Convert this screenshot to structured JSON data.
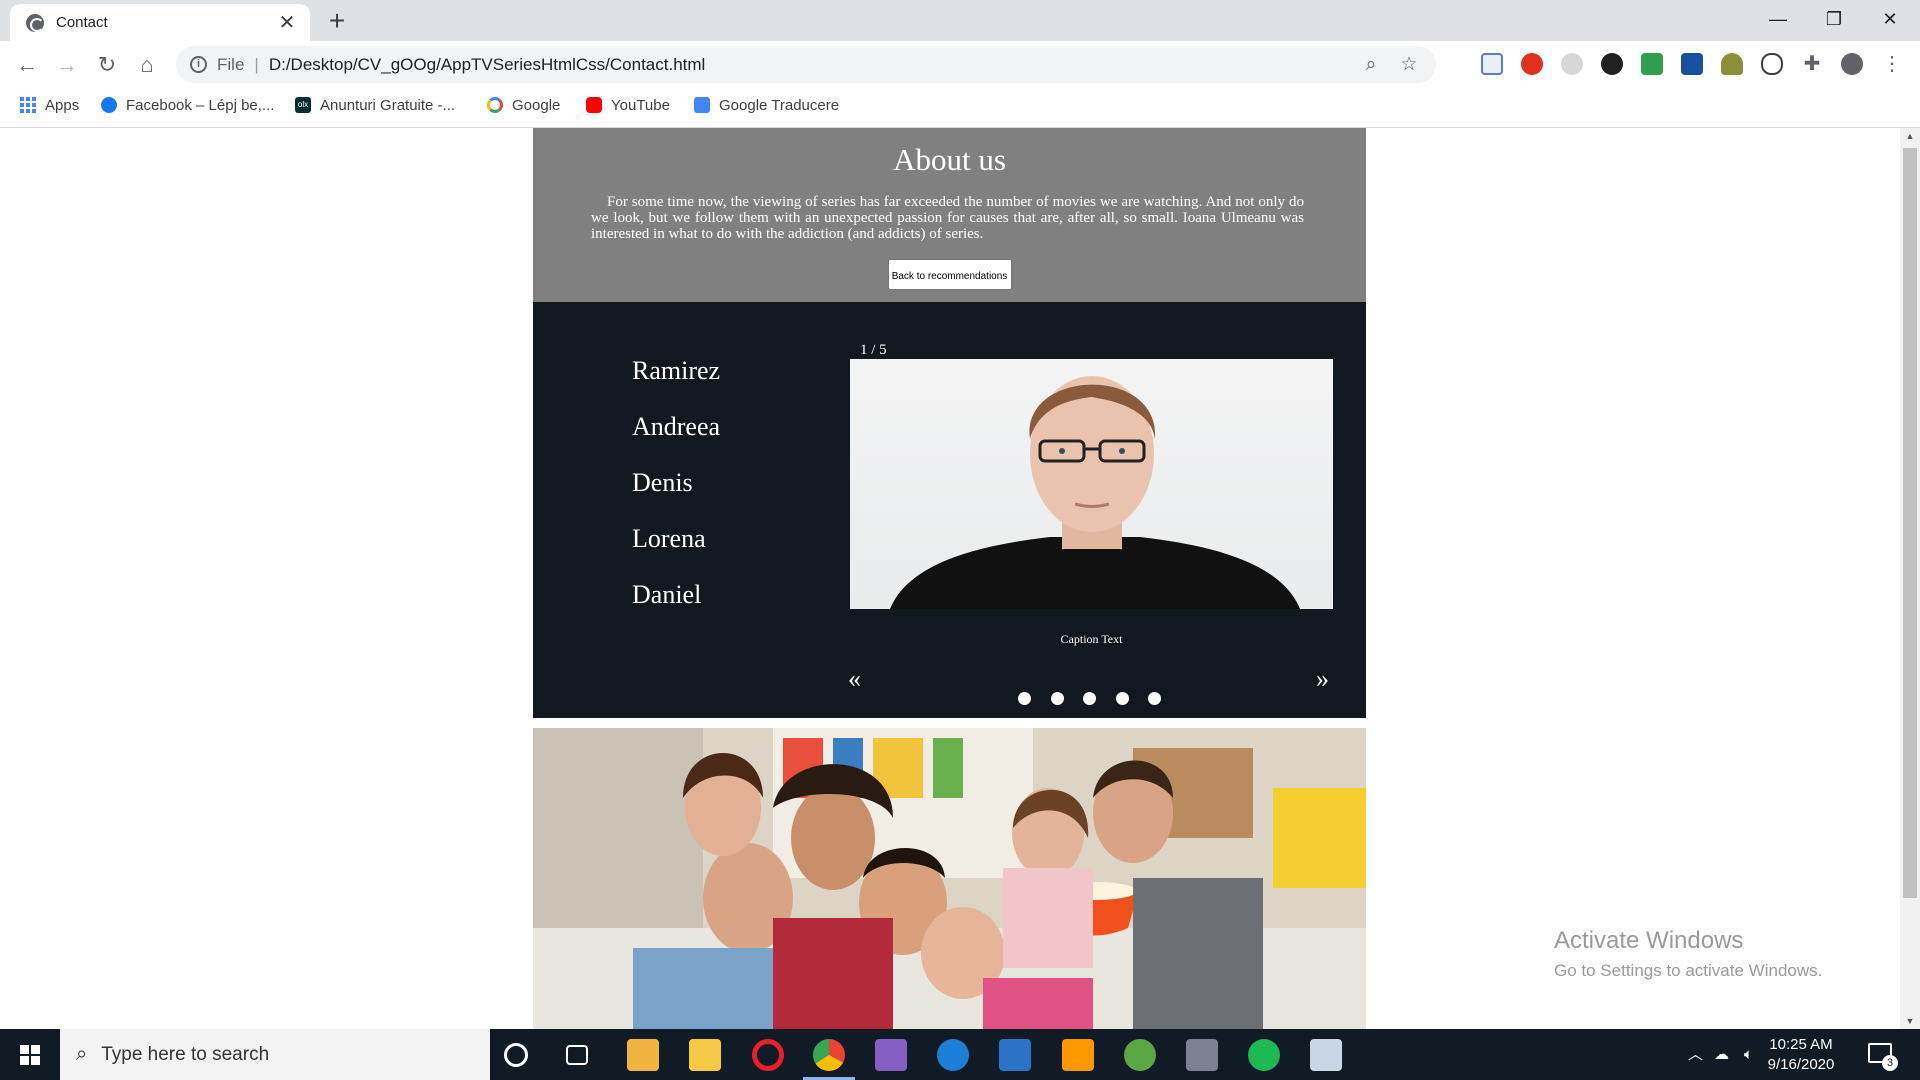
{
  "browser": {
    "tab_title": "Contact",
    "omnibox_scheme_label": "File",
    "url": "D:/Desktop/CV_gOOg/AppTVSeriesHtmlCss/Contact.html"
  },
  "bookmarks": [
    {
      "label": "Apps",
      "icon": "apps-grid-icon"
    },
    {
      "label": "Facebook – Lépj be,...",
      "icon": "facebook-icon",
      "color": "#1877f2"
    },
    {
      "label": "Anunturi Gratuite -...",
      "icon": "olx-icon",
      "color": "#002f34"
    },
    {
      "label": "Google",
      "icon": "google-icon",
      "color": "#4285f4"
    },
    {
      "label": "YouTube",
      "icon": "youtube-icon",
      "color": "#ff0000"
    },
    {
      "label": "Google Traducere",
      "icon": "google-translate-icon",
      "color": "#4285f4"
    }
  ],
  "about": {
    "title": "About us",
    "text": "For some time now, the viewing of series has far exceeded the number of movies we are watching. And not only do we look, but we follow them with an unexpected passion for causes that are, after all, so small. Ioana Ulmeanu was interested in what to do with the addiction (and addicts) of series.",
    "back_button": "Back to recommendations"
  },
  "team": {
    "names": [
      "Ramirez",
      "Andreea",
      "Denis",
      "Lorena",
      "Daniel"
    ],
    "slideshow": {
      "counter": "1 / 5",
      "caption": "Caption Text",
      "prev": "«",
      "next": "»",
      "dot_count": 5,
      "active_slide": 1
    }
  },
  "watermark": {
    "title": "Activate Windows",
    "subtitle": "Go to Settings to activate Windows."
  },
  "taskbar": {
    "search_placeholder": "Type here to search",
    "time": "10:25 AM",
    "date": "9/16/2020",
    "notification_count": "3"
  },
  "colors": {
    "about_bg": "#808080",
    "team_bg": "#111820",
    "taskbar_bg": "#101b26"
  }
}
